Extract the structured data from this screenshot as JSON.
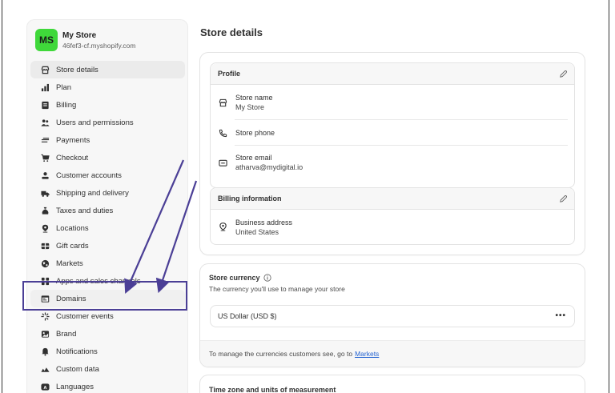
{
  "store": {
    "initials": "MS",
    "name": "My Store",
    "domain": "46fef3-cf.myshopify.com"
  },
  "sidebar": {
    "items": [
      {
        "label": "Store details",
        "icon": "store-icon"
      },
      {
        "label": "Plan",
        "icon": "plan-icon"
      },
      {
        "label": "Billing",
        "icon": "billing-icon"
      },
      {
        "label": "Users and permissions",
        "icon": "users-icon"
      },
      {
        "label": "Payments",
        "icon": "payments-icon"
      },
      {
        "label": "Checkout",
        "icon": "cart-icon"
      },
      {
        "label": "Customer accounts",
        "icon": "person-icon"
      },
      {
        "label": "Shipping and delivery",
        "icon": "truck-icon"
      },
      {
        "label": "Taxes and duties",
        "icon": "taxes-icon"
      },
      {
        "label": "Locations",
        "icon": "location-icon"
      },
      {
        "label": "Gift cards",
        "icon": "gift-card-icon"
      },
      {
        "label": "Markets",
        "icon": "globe-icon"
      },
      {
        "label": "Apps and sales channels",
        "icon": "apps-icon"
      },
      {
        "label": "Domains",
        "icon": "domains-icon"
      },
      {
        "label": "Customer events",
        "icon": "events-icon"
      },
      {
        "label": "Brand",
        "icon": "brand-icon"
      },
      {
        "label": "Notifications",
        "icon": "bell-icon"
      },
      {
        "label": "Custom data",
        "icon": "custom-data-icon"
      },
      {
        "label": "Languages",
        "icon": "languages-icon"
      }
    ]
  },
  "page": {
    "title": "Store details"
  },
  "profile": {
    "title": "Profile",
    "store_name_label": "Store name",
    "store_name_value": "My Store",
    "store_phone_label": "Store phone",
    "store_email_label": "Store email",
    "store_email_value": "atharva@mydigital.io"
  },
  "billing": {
    "title": "Billing information",
    "address_label": "Business address",
    "address_value": "United States"
  },
  "currency": {
    "title": "Store currency",
    "subtitle": "The currency you'll use to manage your store",
    "value": "US Dollar (USD $)",
    "more": "•••",
    "footer_text": "To manage the currencies customers see, go to",
    "footer_link": "Markets"
  },
  "timezone": {
    "title": "Time zone and units of measurement"
  },
  "colors": {
    "avatar": "#3fd83a",
    "link": "#2463d1",
    "annotation": "#4b3f96"
  }
}
